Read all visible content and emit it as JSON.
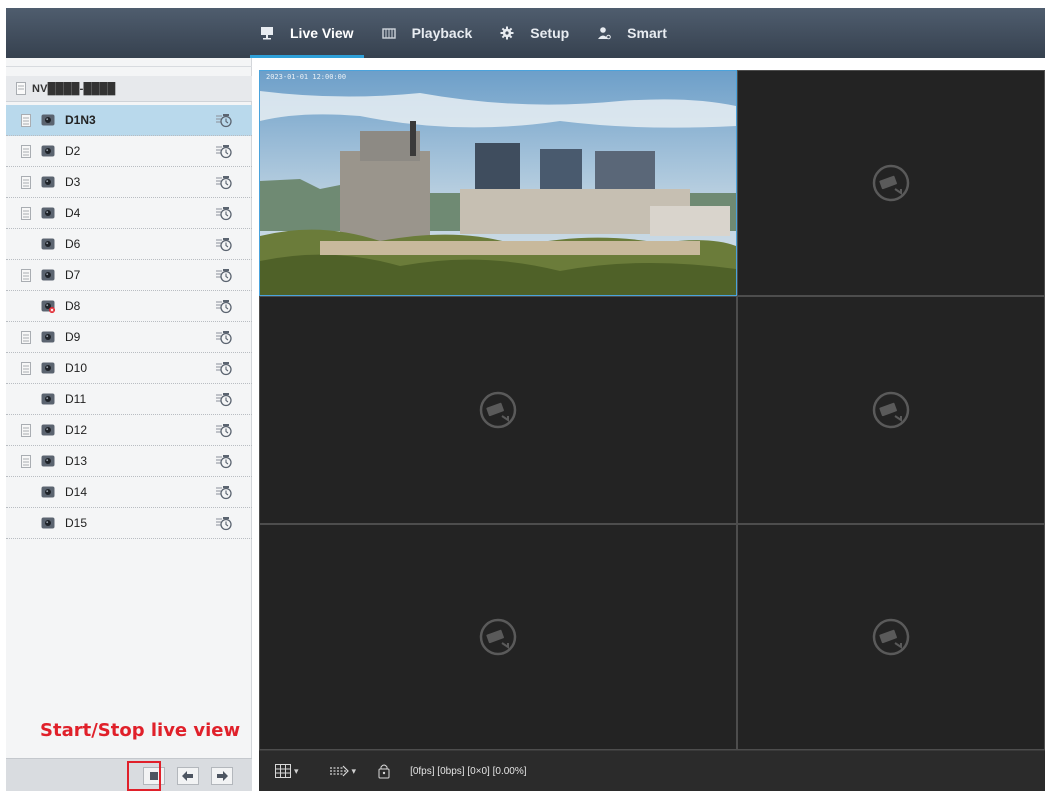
{
  "nav": {
    "items": [
      {
        "label": "Live View",
        "icon": "monitor-icon",
        "active": true
      },
      {
        "label": "Playback",
        "icon": "film-icon",
        "active": false
      },
      {
        "label": "Setup",
        "icon": "gear-icon",
        "active": false
      },
      {
        "label": "Smart",
        "icon": "person-icon",
        "active": false
      }
    ],
    "accent": "#2e9fd8"
  },
  "sidebar": {
    "device_label": "NV████-████",
    "cameras": [
      {
        "name": "D1N3",
        "selected": true,
        "signal": true,
        "status": "online"
      },
      {
        "name": "D2",
        "selected": false,
        "signal": true,
        "status": "online"
      },
      {
        "name": "D3",
        "selected": false,
        "signal": true,
        "status": "online"
      },
      {
        "name": "D4",
        "selected": false,
        "signal": true,
        "status": "online"
      },
      {
        "name": "D6",
        "selected": false,
        "signal": false,
        "status": "online"
      },
      {
        "name": "D7",
        "selected": false,
        "signal": true,
        "status": "online"
      },
      {
        "name": "D8",
        "selected": false,
        "signal": false,
        "status": "offline"
      },
      {
        "name": "D9",
        "selected": false,
        "signal": true,
        "status": "online"
      },
      {
        "name": "D10",
        "selected": false,
        "signal": true,
        "status": "online"
      },
      {
        "name": "D11",
        "selected": false,
        "signal": false,
        "status": "online"
      },
      {
        "name": "D12",
        "selected": false,
        "signal": true,
        "status": "online"
      },
      {
        "name": "D13",
        "selected": false,
        "signal": true,
        "status": "online"
      },
      {
        "name": "D14",
        "selected": false,
        "signal": false,
        "status": "online"
      },
      {
        "name": "D15",
        "selected": false,
        "signal": false,
        "status": "online"
      }
    ],
    "annotation": "Start/Stop live view",
    "buttons": [
      "stop-icon",
      "arrow-left-icon",
      "arrow-right-icon"
    ]
  },
  "grid": {
    "osd_text": "2023-01-01 12:00:00",
    "active_cell": 0
  },
  "toolbar": {
    "status": "[0fps] [0bps] [0×0] [0.00%]"
  }
}
